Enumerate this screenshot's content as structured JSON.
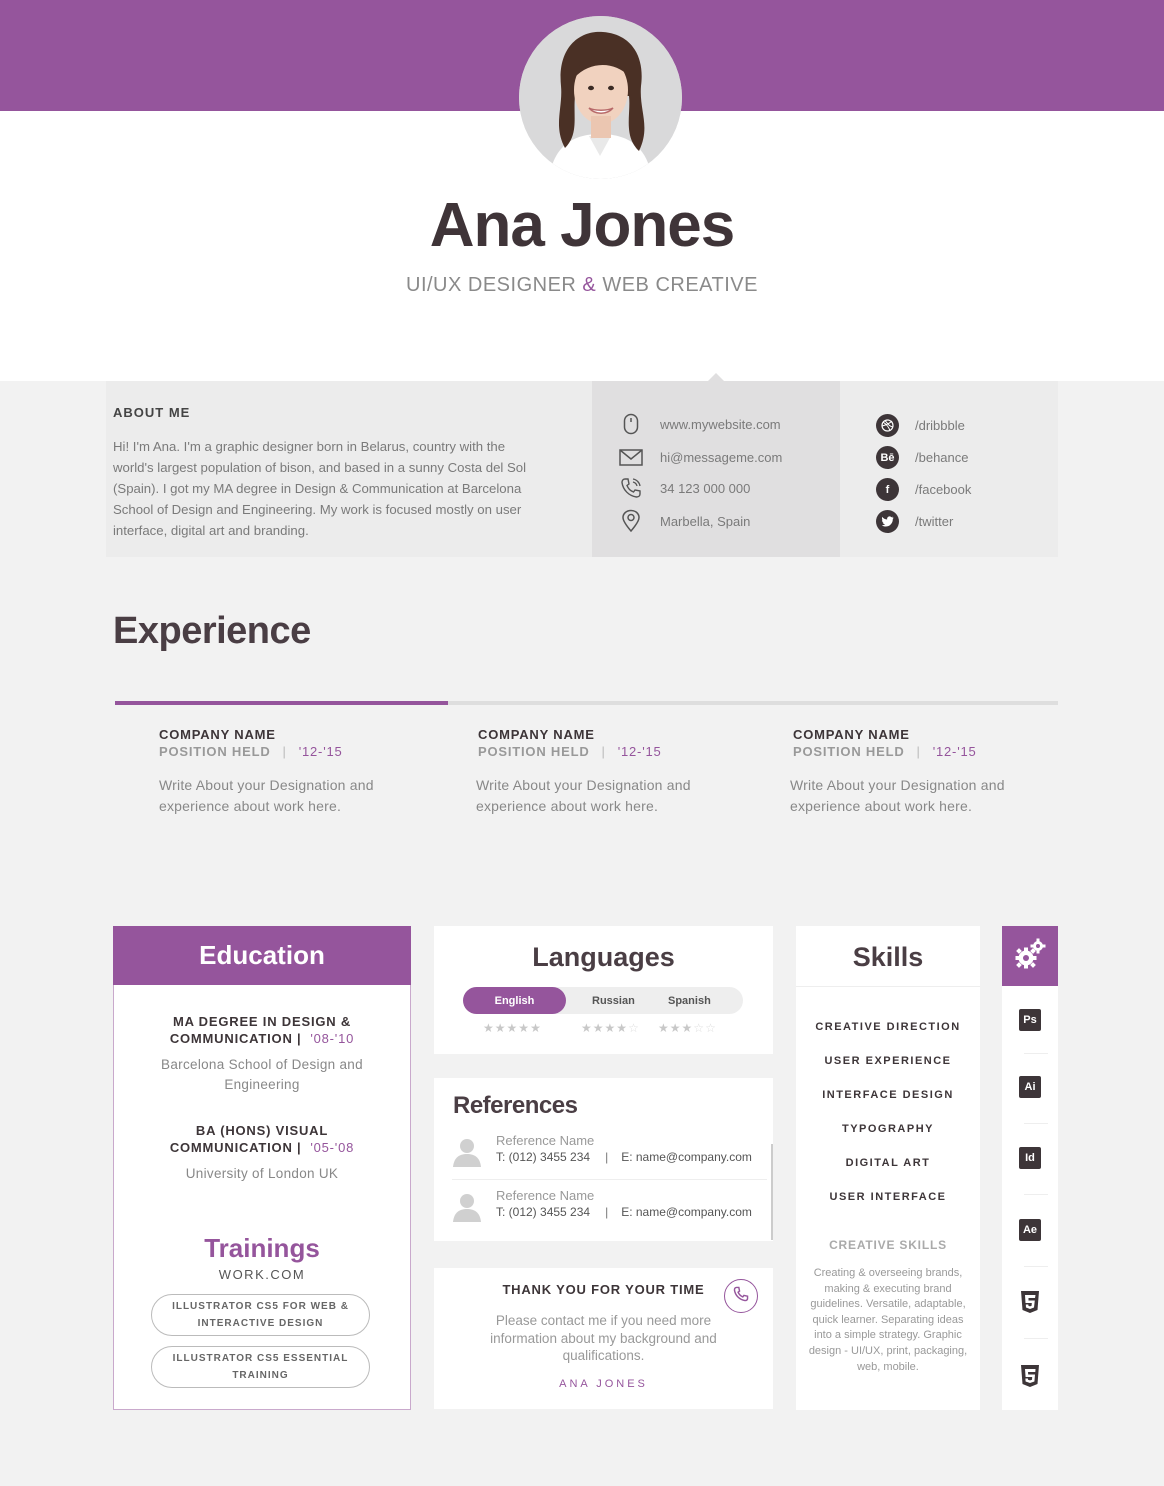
{
  "header": {
    "name": "Ana Jones",
    "title_part1": "UI/UX DESIGNER",
    "title_amp": "&",
    "title_part2": "WEB CREATIVE"
  },
  "about": {
    "heading": "ABOUT ME",
    "text": "Hi! I'm Ana. I'm a graphic designer born in Belarus, country with the world's largest population of bison, and based in a sunny Costa del Sol (Spain). I got my MA degree in Design & Communication at Barcelona School of Design and Engineering. My work is focused mostly on user interface, digital art and branding."
  },
  "contact": {
    "website": "www.mywebsite.com",
    "email": "hi@messageme.com",
    "phone": "34 123 000 000",
    "location": "Marbella, Spain"
  },
  "social": [
    {
      "label": "/dribbble",
      "icon": "dribbble-icon"
    },
    {
      "label": "/behance",
      "icon": "behance-icon",
      "glyph": "Bē"
    },
    {
      "label": "/facebook",
      "icon": "facebook-icon",
      "glyph": "f"
    },
    {
      "label": "/twitter",
      "icon": "twitter-icon"
    }
  ],
  "experience": {
    "heading": "Experience",
    "jobs": [
      {
        "company": "COMPANY NAME",
        "position": "POSITION HELD",
        "sep": "|",
        "years": "'12-'15",
        "desc": "Write About your Designation and experience about work here."
      },
      {
        "company": "COMPANY NAME",
        "position": "POSITION HELD",
        "sep": "|",
        "years": "'12-'15",
        "desc": "Write About your Designation and experience about work here."
      },
      {
        "company": "COMPANY NAME",
        "position": "POSITION HELD",
        "sep": "|",
        "years": "'12-'15",
        "desc": "Write About your Designation and experience about work here."
      }
    ]
  },
  "education": {
    "heading": "Education",
    "degrees": [
      {
        "line1": "MA DEGREE IN DESIGN &",
        "line2": "COMMUNICATION  |",
        "years": "'08-'10",
        "school": "Barcelona School of Design and Engineering"
      },
      {
        "line1": "BA (HONS) VISUAL",
        "line2": "COMMUNICATION  |",
        "years": "'05-'08",
        "school": "University of London UK"
      }
    ],
    "trainings_heading": "Trainings",
    "trainings_source": "WORK.COM",
    "trainings": [
      {
        "line1": "ILLUSTRATOR CS5 FOR WEB &",
        "line2": "INTERACTIVE DESIGN"
      },
      {
        "line1": "ILLUSTRATOR CS5 ESSENTIAL",
        "line2": "TRAINING"
      }
    ]
  },
  "languages": {
    "heading": "Languages",
    "items": [
      {
        "name": "English",
        "rating": 5,
        "max": 5
      },
      {
        "name": "Russian",
        "rating": 4,
        "max": 5
      },
      {
        "name": "Spanish",
        "rating": 3,
        "max": 5
      }
    ],
    "selected": "English"
  },
  "references": {
    "heading": "References",
    "items": [
      {
        "name": "Reference Name",
        "phone": "T: (012) 3455 234",
        "sep": "|",
        "email": "E: name@company.com"
      },
      {
        "name": "Reference Name",
        "phone": "T: (012) 3455 234",
        "sep": "|",
        "email": "E: name@company.com"
      }
    ]
  },
  "thanks": {
    "heading": "THANK YOU FOR YOUR TIME",
    "text": "Please contact me if you need more information about my background and qualifications.",
    "signature": "ANA JONES"
  },
  "skills": {
    "heading": "Skills",
    "items": [
      "CREATIVE DIRECTION",
      "USER EXPERIENCE",
      "INTERFACE DESIGN",
      "TYPOGRAPHY",
      "DIGITAL ART",
      "USER INTERFACE"
    ],
    "creative_heading": "CREATIVE SKILLS",
    "creative_text": "Creating & overseeing brands, making & executing brand guidelines. Versatile, adaptable, quick learner. Separating ideas into a simple strategy. Graphic design - UI/UX, print, packaging, web, mobile."
  },
  "tools": [
    {
      "label": "Ps",
      "icon": "photoshop-icon"
    },
    {
      "label": "Ai",
      "icon": "illustrator-icon"
    },
    {
      "label": "Id",
      "icon": "indesign-icon"
    },
    {
      "label": "Ae",
      "icon": "after-effects-icon"
    },
    {
      "label": "",
      "icon": "css3-icon"
    },
    {
      "label": "",
      "icon": "html5-icon"
    }
  ],
  "colors": {
    "accent": "#95559c",
    "dark": "#3d3538",
    "background": "#f2f2f2"
  }
}
